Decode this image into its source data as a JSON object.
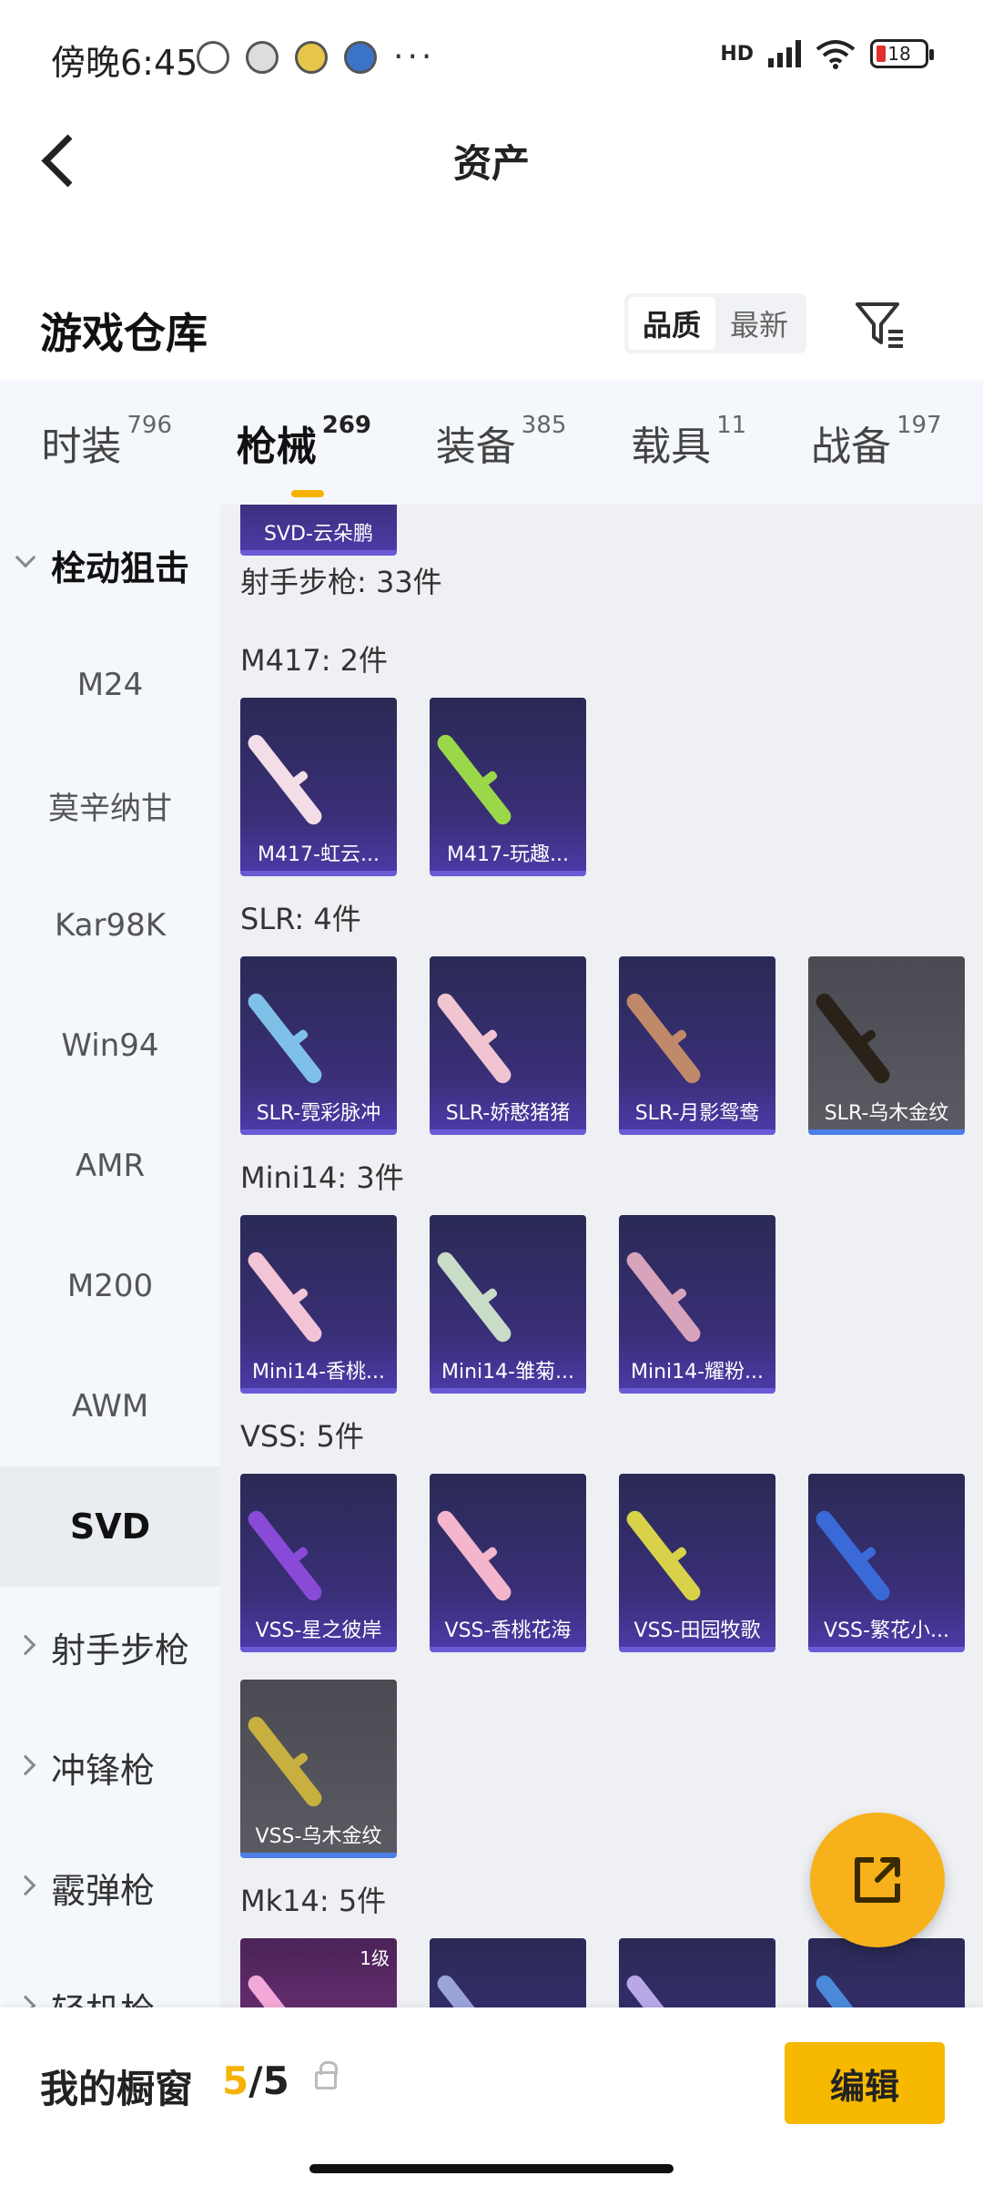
{
  "status_bar": {
    "time": "傍晚6:45",
    "more": "···",
    "network": "HD",
    "battery": "18"
  },
  "header": {
    "title": "资产"
  },
  "section": {
    "title": "游戏仓库",
    "sort_options": [
      "品质",
      "最新"
    ],
    "sort_active": "品质"
  },
  "tabs": [
    {
      "label": "时装",
      "count": "796"
    },
    {
      "label": "枪械",
      "count": "269",
      "active": true
    },
    {
      "label": "装备",
      "count": "385"
    },
    {
      "label": "载具",
      "count": "11"
    },
    {
      "label": "战备",
      "count": "197"
    }
  ],
  "sidebar": {
    "groups": [
      {
        "label": "栓动狙击",
        "open": true
      },
      {
        "label": "射手步枪"
      },
      {
        "label": "冲锋枪"
      },
      {
        "label": "霰弹枪"
      },
      {
        "label": "轻机枪"
      }
    ],
    "items": [
      "M24",
      "莫辛纳甘",
      "Kar98K",
      "Win94",
      "AMR",
      "M200",
      "AWM",
      "SVD"
    ],
    "selected": "SVD"
  },
  "content": {
    "top_card": "SVD-云朵鹏",
    "category_heading": "射手步枪: 33件",
    "groups": [
      {
        "label": "M417: 2件",
        "items": [
          "M417-虹云...",
          "M417-玩趣..."
        ]
      },
      {
        "label": "SLR: 4件",
        "items": [
          "SLR-霓彩脉冲",
          "SLR-娇憨猪猪",
          "SLR-月影鸳鸯",
          "SLR-乌木金纹"
        ]
      },
      {
        "label": "Mini14: 3件",
        "items": [
          "Mini14-香桃...",
          "Mini14-雏菊...",
          "Mini14-耀粉..."
        ]
      },
      {
        "label": "VSS: 5件",
        "items": [
          "VSS-星之彼岸",
          "VSS-香桃花海",
          "VSS-田园牧歌",
          "VSS-繁花小...",
          "VSS-乌木金纹"
        ]
      },
      {
        "label": "Mk14: 5件",
        "items": []
      }
    ],
    "level_badge": "1级"
  },
  "bottom_bar": {
    "label": "我的橱窗",
    "current": "5",
    "sep": "/",
    "total": "5",
    "edit_label": "编辑"
  },
  "colors": {
    "accent": "#f5b300",
    "card_purple": "#3a2f78",
    "card_dark": "#4a4b52"
  }
}
